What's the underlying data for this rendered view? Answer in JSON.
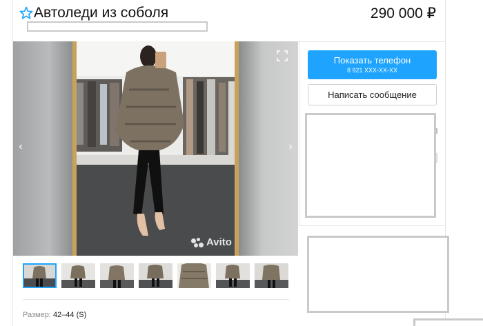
{
  "header": {
    "title": "Автоледи из соболя",
    "price": "290 000 ₽",
    "favorite_icon": "star-outline-icon"
  },
  "gallery": {
    "watermark": "Avito",
    "prev_icon": "chevron-left-icon",
    "next_icon": "chevron-right-icon",
    "fullscreen_icon": "expand-icon",
    "thumbnail_count": 7,
    "active_thumbnail": 1
  },
  "params": {
    "size_label": "Размер:",
    "size_value": "42–44 (S)"
  },
  "contact": {
    "phone_button_label": "Показать телефон",
    "phone_masked": "8 921 XXX-XX-XX",
    "message_button_label": "Написать сообщение"
  },
  "colors": {
    "accent": "#1ea4ff",
    "placeholder_border": "#c9c9c9"
  }
}
